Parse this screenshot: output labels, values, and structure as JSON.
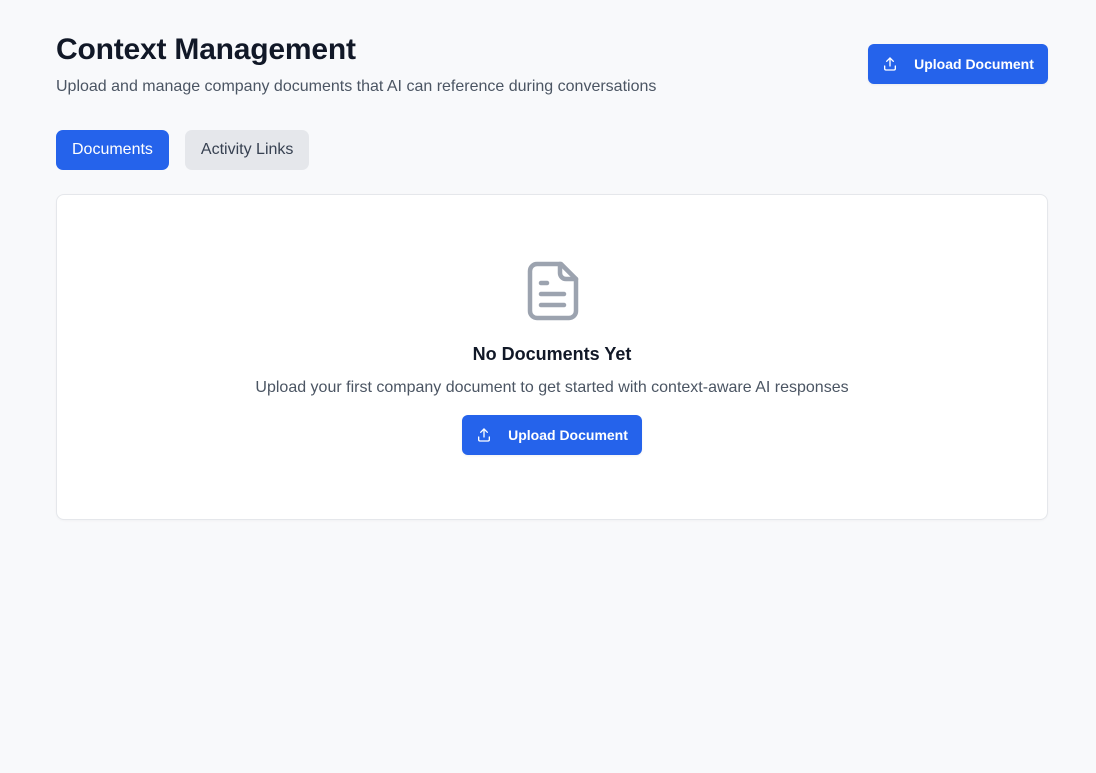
{
  "header": {
    "title": "Context Management",
    "subtitle": "Upload and manage company documents that AI can reference during conversations",
    "upload_label": "Upload Document"
  },
  "tabs": [
    {
      "label": "Documents",
      "active": true
    },
    {
      "label": "Activity Links",
      "active": false
    }
  ],
  "empty_state": {
    "icon": "document-icon",
    "title": "No Documents Yet",
    "text": "Upload your first company document to get started with context-aware AI responses",
    "upload_label": "Upload Document"
  },
  "colors": {
    "primary": "#2563eb",
    "background": "#f8f9fb",
    "tab_inactive": "#e5e7eb",
    "icon_gray": "#9ca3af"
  }
}
